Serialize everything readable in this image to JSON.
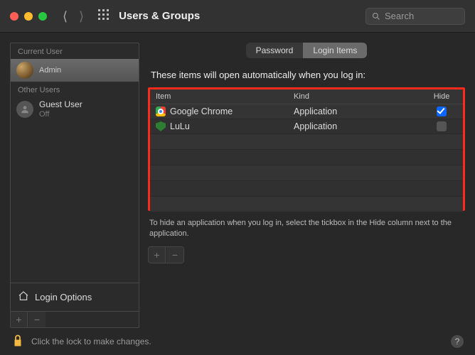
{
  "window": {
    "title": "Users & Groups",
    "search_placeholder": "Search"
  },
  "tabs": {
    "password": "Password",
    "login_items": "Login Items"
  },
  "sidebar": {
    "current_header": "Current User",
    "other_header": "Other Users",
    "current": {
      "name": "",
      "role": "Admin"
    },
    "other": [
      {
        "name": "Guest User",
        "role": "Off"
      }
    ],
    "login_options": "Login Options"
  },
  "main": {
    "caption": "These items will open automatically when you log in:",
    "columns": {
      "item": "Item",
      "kind": "Kind",
      "hide": "Hide"
    },
    "rows": [
      {
        "name": "Google Chrome",
        "kind": "Application",
        "icon": "chrome",
        "hide": true
      },
      {
        "name": "LuLu",
        "kind": "Application",
        "icon": "lulu",
        "hide": false
      }
    ],
    "hint": "To hide an application when you log in, select the tickbox in the Hide column next to the application."
  },
  "footer": {
    "lock_text": "Click the lock to make changes."
  },
  "glyph": {
    "plus": "+",
    "minus": "−",
    "help": "?"
  }
}
